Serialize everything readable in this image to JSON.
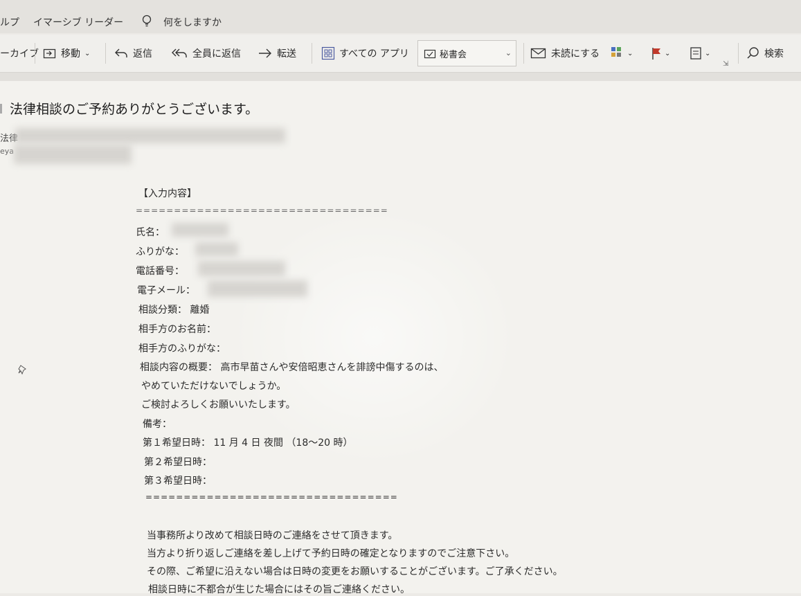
{
  "menu": {
    "help_partial": "ルプ",
    "immersive_reader": "イマーシブ リーダー",
    "tell_me": "何をしますか"
  },
  "ribbon": {
    "archive_partial": "ーカイブ",
    "move": "移動",
    "reply": "返信",
    "reply_all": "全員に返信",
    "forward": "転送",
    "all_apps": "すべての アプリ",
    "quick_step": "秘書会",
    "mark_unread": "未読にする",
    "search": "検索"
  },
  "message": {
    "subject": "法律相談のご予約ありがとうございます。",
    "sender_partial": "法律",
    "recipient_partial": "eya"
  },
  "body": {
    "header": "【入力内容】",
    "divider_top": "=================================",
    "name_label": "氏名：",
    "furigana_label": "ふりがな：",
    "phone_label": "電話番号：",
    "email_label": "電子メール：",
    "category": "相談分類： 離婚",
    "opponent_name": "相手方のお名前：",
    "opponent_furigana": "相手方のふりがな：",
    "summary_line1": "相談内容の概要： 高市早苗さんや安倍昭恵さんを誹謗中傷するのは、",
    "summary_line2": "やめていただけないでしょうか。",
    "summary_line3": "ご検討よろしくお願いいたします。",
    "remarks": "備考：",
    "pref1": "第１希望日時： 11 月 4 日 夜間 （18～20 時）",
    "pref2": "第２希望日時：",
    "pref3": "第３希望日時：",
    "divider_bottom": "=================================",
    "note1": "当事務所より改めて相談日時のご連絡をさせて頂きます。",
    "note2": "当方より折り返しご連絡を差し上げて予約日時の確定となりますのでご注意下さい。",
    "note3": "その際、ご希望に沿えない場合は日時の変更をお願いすることがございます。ご了承ください。",
    "note4": "相談日時に不都合が生じた場合にはその旨ご連絡ください。"
  }
}
